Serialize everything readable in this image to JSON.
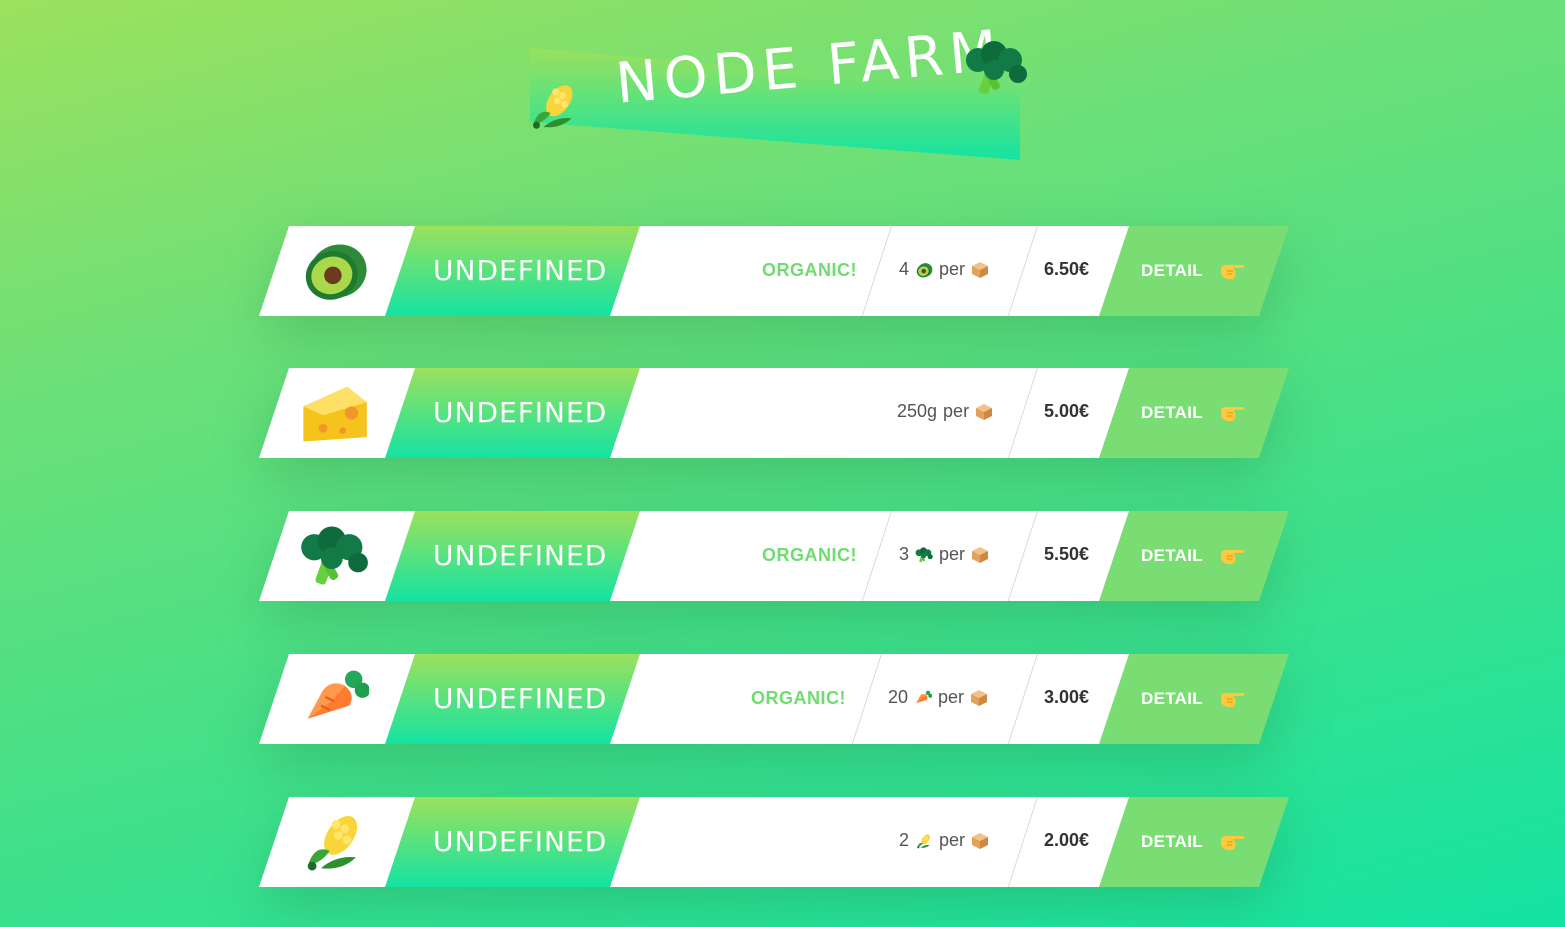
{
  "app": {
    "title": "NODE FARM",
    "header_icons": [
      "corn-icon",
      "broccoli-icon"
    ]
  },
  "colors": {
    "gradient_start": "#9be15d",
    "gradient_end": "#14e3a2",
    "organic_text": "#6fdc6f",
    "detail_bg": "#79dd73"
  },
  "products": [
    {
      "icon": "avocado-icon",
      "name": "UNDEFINED",
      "organic": "ORGANIC!",
      "quantity": "4",
      "quantity_icon": "avocado-icon",
      "per": "per",
      "per_icon": "box-icon",
      "price": "6.50€",
      "detail_label": "DETAIL",
      "detail_icon": "pointing-hand-icon"
    },
    {
      "icon": "cheese-icon",
      "name": "UNDEFINED",
      "organic": "",
      "quantity": "250g",
      "quantity_icon": "",
      "per": "per",
      "per_icon": "box-icon",
      "price": "5.00€",
      "detail_label": "DETAIL",
      "detail_icon": "pointing-hand-icon"
    },
    {
      "icon": "broccoli-icon",
      "name": "UNDEFINED",
      "organic": "ORGANIC!",
      "quantity": "3",
      "quantity_icon": "broccoli-icon",
      "per": "per",
      "per_icon": "box-icon",
      "price": "5.50€",
      "detail_label": "DETAIL",
      "detail_icon": "pointing-hand-icon"
    },
    {
      "icon": "carrot-icon",
      "name": "UNDEFINED",
      "organic": "ORGANIC!",
      "quantity": "20",
      "quantity_icon": "carrot-icon",
      "per": "per",
      "per_icon": "box-icon",
      "price": "3.00€",
      "detail_label": "DETAIL",
      "detail_icon": "pointing-hand-icon"
    },
    {
      "icon": "corn-icon",
      "name": "UNDEFINED",
      "organic": "",
      "quantity": "2",
      "quantity_icon": "corn-icon",
      "per": "per",
      "per_icon": "box-icon",
      "price": "2.00€",
      "detail_label": "DETAIL",
      "detail_icon": "pointing-hand-icon"
    }
  ]
}
